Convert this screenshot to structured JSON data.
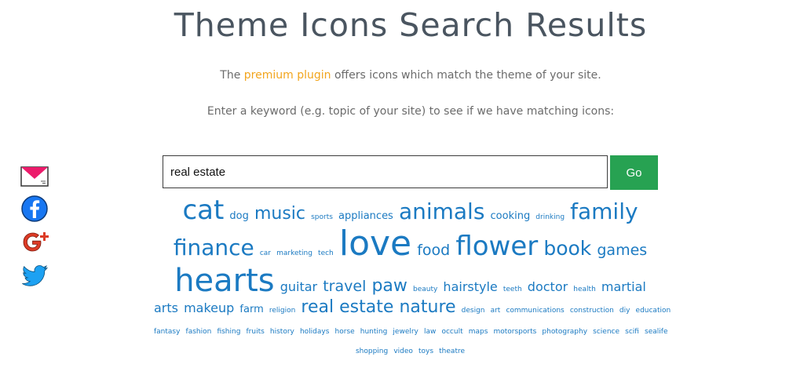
{
  "page": {
    "title": "Theme Icons Search Results",
    "subtitle_before": "The ",
    "subtitle_link": "premium plugin",
    "subtitle_after": " offers icons which match the theme of your site.",
    "prompt": "Enter a keyword (e.g. topic of your site) to see if we have matching icons:"
  },
  "search": {
    "value": "real estate",
    "button_label": "Go"
  },
  "share_icons": [
    "email-icon",
    "facebook-icon",
    "google-plus-icon",
    "twitter-icon"
  ],
  "colors": {
    "link": "#1b7ac2",
    "accent": "#f2a51d",
    "button": "#27a252",
    "title": "#4a5560"
  },
  "tag_cloud": [
    [
      "cat",
      "dog",
      "music",
      "sports",
      "appliances",
      "animals",
      "cooking",
      "drinking",
      "family"
    ],
    [
      "finance",
      "car",
      "marketing",
      "tech",
      "love",
      "food",
      "flower",
      "book",
      "games"
    ],
    [
      "hearts",
      "guitar",
      "travel",
      "paw",
      "beauty",
      "hairstyle",
      "teeth",
      "doctor",
      "health",
      "martial"
    ],
    [
      "arts",
      "makeup",
      "farm",
      "religion",
      "real estate",
      "nature",
      "design",
      "art",
      "communications",
      "construction",
      "diy",
      "education"
    ],
    [
      "fantasy",
      "fashion",
      "fishing",
      "fruits",
      "history",
      "holidays",
      "horse",
      "hunting",
      "jewelry",
      "law",
      "occult",
      "maps",
      "motorsports",
      "photography",
      "science",
      "scifi",
      "sealife"
    ],
    [
      "shopping",
      "video",
      "toys",
      "theatre"
    ]
  ]
}
